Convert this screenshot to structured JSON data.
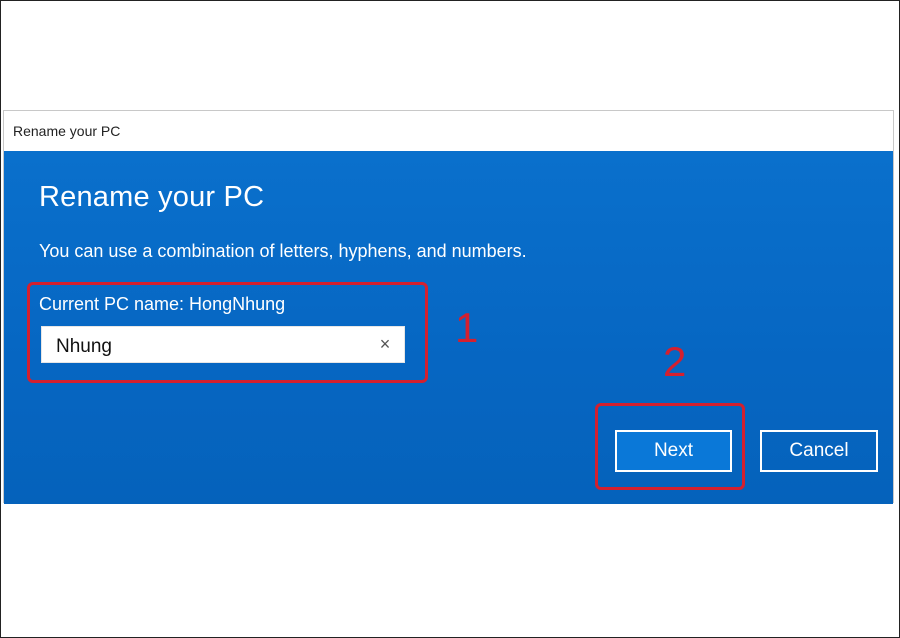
{
  "window": {
    "title": "Rename your PC"
  },
  "dialog": {
    "heading": "Rename your PC",
    "description": "You can use a combination of letters, hyphens, and numbers.",
    "current_name_label": "Current PC name: HongNhung",
    "input_value": "Nhung",
    "clear_icon": "×"
  },
  "buttons": {
    "next_label": "Next",
    "cancel_label": "Cancel"
  },
  "annotations": {
    "step1": "1",
    "step2": "2"
  },
  "colors": {
    "dialog_blue": "#0a70cc",
    "annotation_red": "#d4202f"
  },
  "icons": {
    "clear": "close-icon"
  }
}
